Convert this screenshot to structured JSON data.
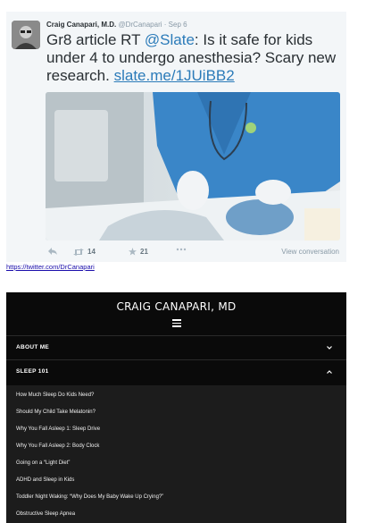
{
  "tweet": {
    "author_name": "Craig Canapari, M.D.",
    "handle": "@DrCanapari",
    "separator": "·",
    "date": "Sep 6",
    "text_prefix": "Gr8 article RT ",
    "mention": "@Slate",
    "text_body": ": Is it safe for kids under 4 to undergo anesthesia? Scary new research. ",
    "url": "slate.me/1JUiBB2",
    "retweet_count": "14",
    "favorite_count": "21",
    "view_conversation": "View conversation"
  },
  "source_link": "https://twitter.com/DrCanapari",
  "site": {
    "title": "CRAIG CANAPARI, MD",
    "menu": [
      {
        "label": "ABOUT ME",
        "state": "collapsed"
      },
      {
        "label": "SLEEP 101",
        "state": "expanded"
      }
    ],
    "submenu": [
      "How Much Sleep Do Kids Need?",
      "Should My Child Take Melatonin?",
      "Why You Fall Asleep 1: Sleep Drive",
      "Why You Fall Asleep 2: Body Clock",
      "Going on a “Light Diet”",
      "ADHD and Sleep in Kids",
      "Toddler Night Waking: “Why Does My Baby Wake Up Crying?”",
      "Obstructive Sleep Apnea"
    ]
  },
  "colors": {
    "link": "#2b7bb9",
    "scrubs": "#3a86c8",
    "nav_bg": "#0a0a0a",
    "submenu_bg": "#1c1c1c"
  }
}
